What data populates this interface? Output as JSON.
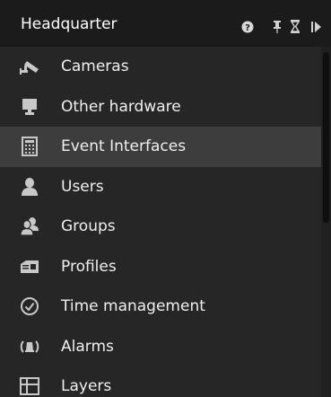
{
  "panel": {
    "title": "Headquarter"
  },
  "items": [
    {
      "label": "Cameras",
      "icon": "camera-icon",
      "selected": false
    },
    {
      "label": "Other hardware",
      "icon": "monitor-icon",
      "selected": false
    },
    {
      "label": "Event Interfaces",
      "icon": "event-interface-icon",
      "selected": true
    },
    {
      "label": "Users",
      "icon": "user-icon",
      "selected": false
    },
    {
      "label": "Groups",
      "icon": "group-icon",
      "selected": false
    },
    {
      "label": "Profiles",
      "icon": "profile-card-icon",
      "selected": false
    },
    {
      "label": "Time management",
      "icon": "clock-icon",
      "selected": false
    },
    {
      "label": "Alarms",
      "icon": "alarm-icon",
      "selected": false
    },
    {
      "label": "Layers",
      "icon": "layers-grid-icon",
      "selected": false
    }
  ],
  "colors": {
    "background": "#262626",
    "titlebar": "#1b1b1b",
    "selected_row": "#3d3d3d",
    "icon": "#c8c8c8",
    "text": "#f0f0f0"
  }
}
